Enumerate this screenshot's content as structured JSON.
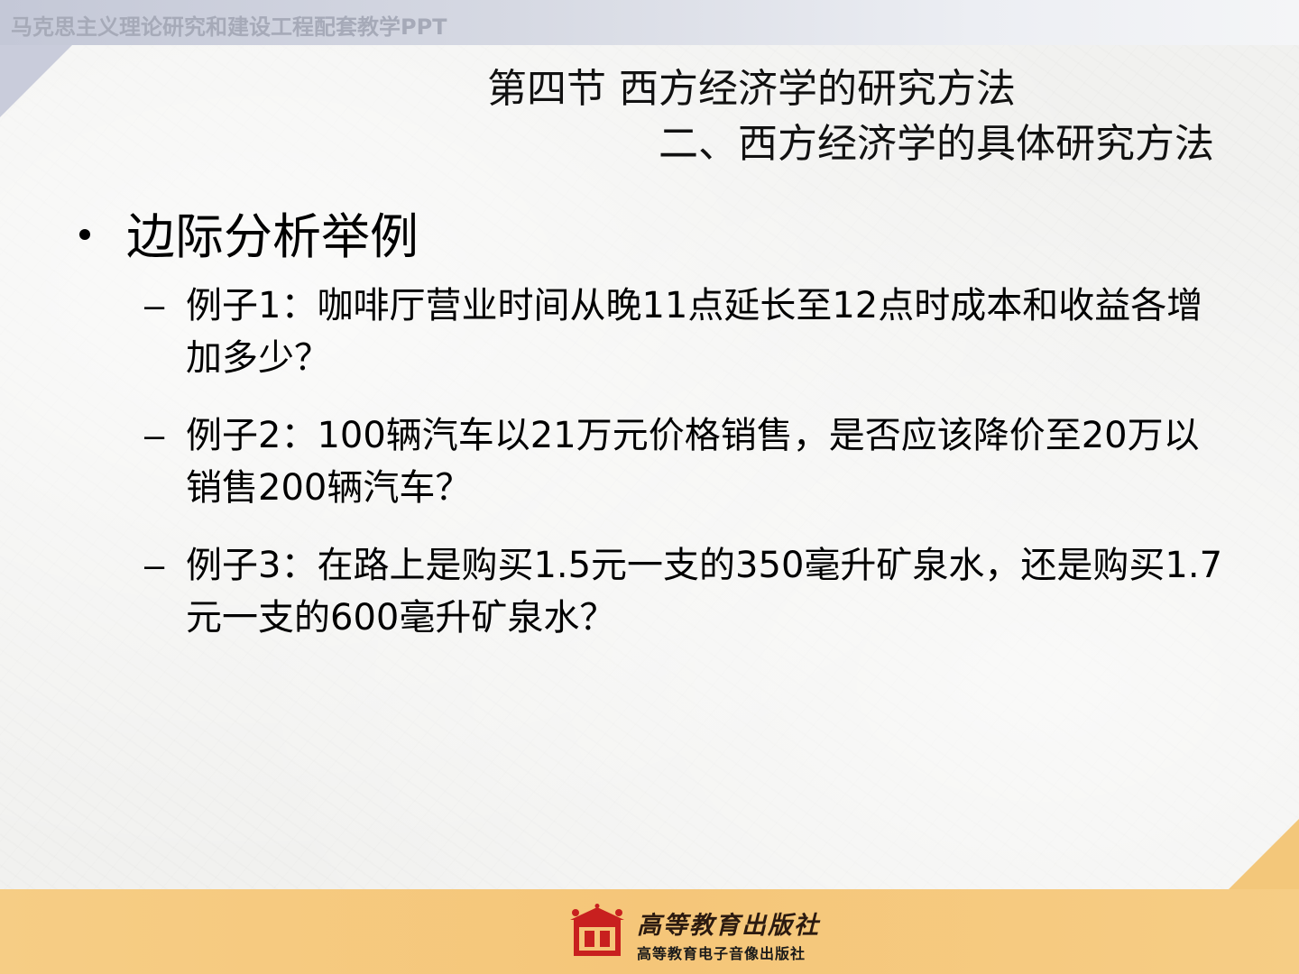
{
  "header": {
    "course_text": "马克思主义理论研究和建设工程配套教学PPT"
  },
  "titles": {
    "section": "第四节  西方经济学的研究方法",
    "subsection": "二、西方经济学的具体研究方法"
  },
  "main_bullet": "边际分析举例",
  "sub_items": [
    {
      "dash": "–",
      "text": "例子1：咖啡厅营业时间从晚11点延长至12点时成本和收益各增加多少？"
    },
    {
      "dash": "–",
      "text": "例子2：100辆汽车以21万元价格销售，是否应该降价至20万以销售200辆汽车？"
    },
    {
      "dash": "–",
      "text": "例子3：在路上是购买1.5元一支的350毫升矿泉水，还是购买1.7元一支的600毫升矿泉水？"
    }
  ],
  "footer": {
    "publisher_calligraphy": "高等教育出版社",
    "publisher_sub": "高等教育电子音像出版社",
    "logo_icon": "publisher-seal-icon"
  },
  "colors": {
    "top_band": "#c4c8d7",
    "footer_band": "#f5c679",
    "logo_red": "#c8201f"
  }
}
